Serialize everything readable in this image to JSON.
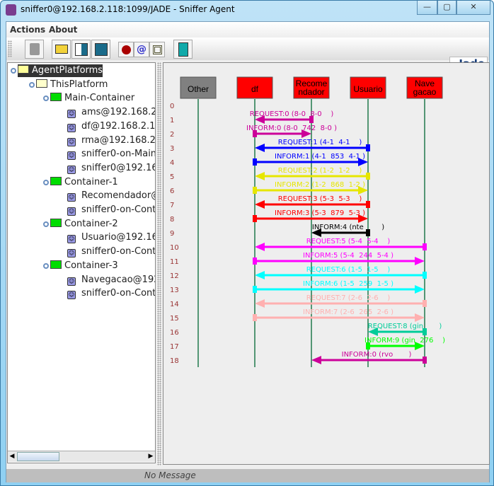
{
  "window": {
    "title": "sniffer0@192.168.2.118:1099/JADE - Sniffer Agent",
    "minimize": "—",
    "maximize": "▢",
    "close": "✕"
  },
  "menu": [
    "Actions",
    "About"
  ],
  "toolbar": {
    "icons": [
      "clear-canvas-icon",
      "open-icon",
      "write-message-list-icon",
      "save-icon",
      "do-sniff-icon",
      "do-not-sniff-icon",
      "show-only-icon",
      "exit-icon"
    ]
  },
  "logo": "Jade",
  "tree": [
    {
      "label": "AgentPlatforms",
      "type": "platform-root",
      "level": 0,
      "selected": true
    },
    {
      "label": "ThisPlatform",
      "type": "platform",
      "level": 1
    },
    {
      "label": "Main-Container",
      "type": "container",
      "level": 2
    },
    {
      "label": "ams@192.168.2.",
      "type": "agent",
      "level": 3
    },
    {
      "label": "df@192.168.2.11",
      "type": "agent",
      "level": 3
    },
    {
      "label": "rma@192.168.2.",
      "type": "agent",
      "level": 3
    },
    {
      "label": "sniffer0-on-Main-",
      "type": "agent",
      "level": 3
    },
    {
      "label": "sniffer0@192.16",
      "type": "agent",
      "level": 3
    },
    {
      "label": "Container-1",
      "type": "container",
      "level": 2
    },
    {
      "label": "Recomendador@",
      "type": "agent",
      "level": 3
    },
    {
      "label": "sniffer0-on-Cont",
      "type": "agent",
      "level": 3
    },
    {
      "label": "Container-2",
      "type": "container",
      "level": 2
    },
    {
      "label": "Usuario@192.16",
      "type": "agent",
      "level": 3
    },
    {
      "label": "sniffer0-on-Cont",
      "type": "agent",
      "level": 3
    },
    {
      "label": "Container-3",
      "type": "container",
      "level": 2
    },
    {
      "label": "Navegacao@192",
      "type": "agent",
      "level": 3
    },
    {
      "label": "sniffer0-on-Cont",
      "type": "agent",
      "level": 3
    }
  ],
  "agents": [
    {
      "lines": [
        "Other"
      ],
      "color": "#808080"
    },
    {
      "lines": [
        "df"
      ],
      "color": "#ff0000"
    },
    {
      "lines": [
        "Recome",
        "ndador"
      ],
      "color": "#ff0000"
    },
    {
      "lines": [
        "Usuario"
      ],
      "color": "#ff0000"
    },
    {
      "lines": [
        "Nave",
        "gacao"
      ],
      "color": "#ff0000"
    }
  ],
  "row_numbers": [
    "0",
    "1",
    "2",
    "3",
    "4",
    "5",
    "6",
    "7",
    "8",
    "9",
    "10",
    "11",
    "12",
    "13",
    "14",
    "15",
    "16",
    "17",
    "18"
  ],
  "messages": [
    {
      "label": "REQUEST:0 (8-0  8-0    )",
      "from": 2,
      "to": 1,
      "color": "#cc0099"
    },
    {
      "label": "INFORM:0 (8-0  742  8-0 )",
      "from": 1,
      "to": 2,
      "color": "#cc0099"
    },
    {
      "label": "REQUEST:1 (4-1  4-1    )",
      "from": 3,
      "to": 1,
      "color": "#0000ff"
    },
    {
      "label": "INFORM:1 (4-1  853  4-1 )",
      "from": 1,
      "to": 3,
      "color": "#0000ff"
    },
    {
      "label": "REQUEST:2 (1-2  1-2    )",
      "from": 3,
      "to": 1,
      "color": "#e6e600"
    },
    {
      "label": "INFORM:2 (1-2  868  1-2 )",
      "from": 1,
      "to": 3,
      "color": "#e6e600"
    },
    {
      "label": "REQUEST:3 (5-3  5-3    )",
      "from": 3,
      "to": 1,
      "color": "#ff0000"
    },
    {
      "label": "INFORM:3 (5-3  879  5-3 )",
      "from": 1,
      "to": 3,
      "color": "#ff0000"
    },
    {
      "label": "INFORM:4 (nte        )",
      "from": 3,
      "to": 2,
      "color": "#000000"
    },
    {
      "label": "REQUEST:5 (5-4  5-4    )",
      "from": 4,
      "to": 1,
      "color": "#ff00ff"
    },
    {
      "label": "INFORM:5 (5-4  244  5-4 )",
      "from": 1,
      "to": 4,
      "color": "#ff00ff"
    },
    {
      "label": "REQUEST:6 (1-5  1-5    )",
      "from": 4,
      "to": 1,
      "color": "#00ffff"
    },
    {
      "label": "INFORM:6 (1-5  259  1-5 )",
      "from": 1,
      "to": 4,
      "color": "#00ffff"
    },
    {
      "label": "REQUEST:7 (2-6  2-6    )",
      "from": 4,
      "to": 1,
      "color": "#ffb0b0"
    },
    {
      "label": "INFORM:7 (2-6  265  2-6 )",
      "from": 1,
      "to": 4,
      "color": "#ffb0b0"
    },
    {
      "label": "REQUEST:8 (gin       )",
      "from": 4,
      "to": 3,
      "color": "#00cc99"
    },
    {
      "label": "INFORM:9 (gin  276    )",
      "from": 3,
      "to": 4,
      "color": "#00ff00"
    },
    {
      "label": "INFORM:0 (rvo       )",
      "from": 4,
      "to": 2,
      "color": "#cc0099"
    }
  ],
  "status": "No Message"
}
